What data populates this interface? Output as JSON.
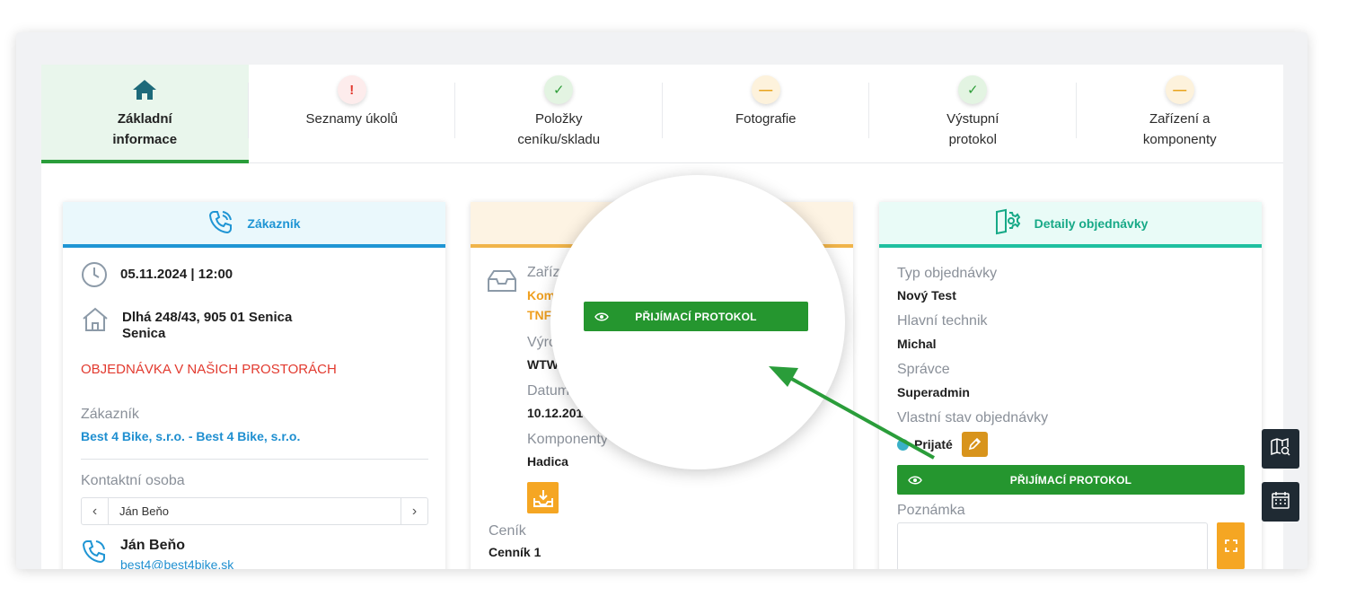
{
  "tabs": [
    {
      "label": "Základní informace",
      "status": "home",
      "icon": "home-icon"
    },
    {
      "label": "Seznamy úkolů",
      "status": "error",
      "symbol": "!"
    },
    {
      "label": "Položky ceníku/skladu",
      "status": "ok",
      "symbol": "✓"
    },
    {
      "label": "Fotografie",
      "status": "warn",
      "symbol": "—"
    },
    {
      "label": "Výstupní protokol",
      "status": "ok",
      "symbol": "✓"
    },
    {
      "label": "Zařízení a komponenty",
      "status": "warn",
      "symbol": "—"
    }
  ],
  "customer_card": {
    "title": "Zákazník",
    "datetime": "05.11.2024 | 12:00",
    "address_line1": "Dlhá 248/43, 905 01 Senica",
    "address_line2": "Senica",
    "order_location": "OBJEDNÁVKA V NAŠICH PROSTORÁCH",
    "customer_label": "Zákazník",
    "customer_value": "Best 4 Bike, s.r.o. - Best 4 Bike, s.r.o.",
    "contact_label": "Kontaktní osoba",
    "contact_selected": "Ján Beňo",
    "contact_name": "Ján Beňo",
    "contact_email": "best4@best4bike.sk"
  },
  "device_card": {
    "device_label": "Zaříz",
    "device_line1": "Kom",
    "device_line2": "TNF",
    "manufacturer_label": "Výro",
    "manufacturer_value": "WTW",
    "date_label": "Datum",
    "date_value": "10.12.201",
    "components_label": "Komponenty",
    "components_value": "Hadica",
    "pricelist_label": "Ceník",
    "pricelist_value": "Cenník 1"
  },
  "magnifier": {
    "button_label": "PŘIJÍMACÍ PROTOKOL"
  },
  "order_card": {
    "title": "Detaily objednávky",
    "type_label": "Typ objednávky",
    "type_value": "Nový Test",
    "technician_label": "Hlavní technik",
    "technician_value": "Michal",
    "admin_label": "Správce",
    "admin_value": "Superadmin",
    "state_label": "Vlastní stav objednávky",
    "state_value": "Prijaté",
    "protocol_button": "PŘIJÍMACÍ PROTOKOL",
    "note_label": "Poznámka",
    "note_value": ""
  },
  "colors": {
    "accent_green": "#25962f",
    "customer_blue": "#1f95d4",
    "order_teal": "#1fc0a0",
    "device_orange": "#f0b44a",
    "warning_red": "#e23a2f"
  }
}
